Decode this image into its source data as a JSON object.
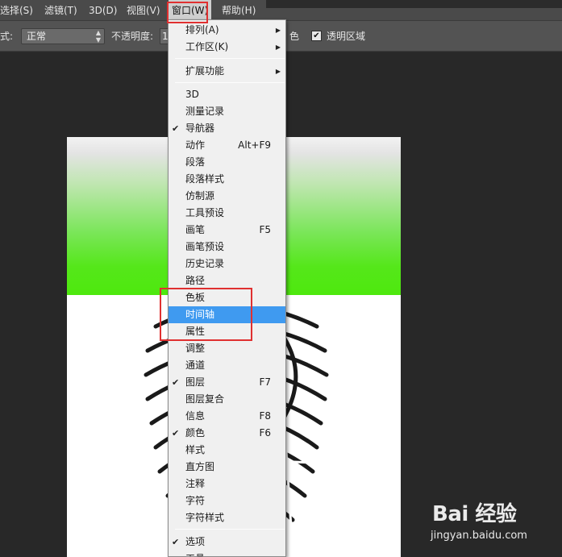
{
  "menubar": {
    "items": [
      {
        "label": "选择(S)"
      },
      {
        "label": "滤镜(T)"
      },
      {
        "label": "3D(D)"
      },
      {
        "label": "视图(V)"
      },
      {
        "label": "窗口(W)"
      },
      {
        "label": "帮助(H)"
      }
    ]
  },
  "options": {
    "mode_label": "式:",
    "mode_value": "正常",
    "opacity_label": "不透明度:",
    "opacity_value": "1",
    "dither_label": "色",
    "transparency_label": "透明区域"
  },
  "window_menu": {
    "items": [
      {
        "label": "排列(A)",
        "submenu": "▶"
      },
      {
        "label": "工作区(K)",
        "submenu": "▶"
      },
      {
        "label": "扩展功能",
        "submenu": "▶"
      },
      {
        "label": "3D"
      },
      {
        "label": "测量记录"
      },
      {
        "label": "导航器",
        "check": "✔"
      },
      {
        "label": "动作",
        "shortcut": "Alt+F9"
      },
      {
        "label": "段落"
      },
      {
        "label": "段落样式"
      },
      {
        "label": "仿制源"
      },
      {
        "label": "工具预设"
      },
      {
        "label": "画笔",
        "shortcut": "F5"
      },
      {
        "label": "画笔预设"
      },
      {
        "label": "历史记录"
      },
      {
        "label": "路径"
      },
      {
        "label": "色板"
      },
      {
        "label": "时间轴"
      },
      {
        "label": "属性"
      },
      {
        "label": "调整"
      },
      {
        "label": "通道"
      },
      {
        "label": "图层",
        "check": "✔",
        "shortcut": "F7"
      },
      {
        "label": "图层复合"
      },
      {
        "label": "信息",
        "shortcut": "F8"
      },
      {
        "label": "颜色",
        "check": "✔",
        "shortcut": "F6"
      },
      {
        "label": "样式"
      },
      {
        "label": "直方图"
      },
      {
        "label": "注释"
      },
      {
        "label": "字符"
      },
      {
        "label": "字符样式"
      },
      {
        "label": "选项",
        "check": "✔"
      },
      {
        "label": "工具",
        "check": "✔"
      }
    ],
    "highlighted": "时间轴"
  },
  "watermark": {
    "logo": "Bai 经验",
    "url": "jingyan.baidu.com"
  },
  "colors": {
    "menu_highlight": "#3f9af0",
    "annotation_red": "#e03030",
    "canvas_green": "#4ee80e"
  }
}
